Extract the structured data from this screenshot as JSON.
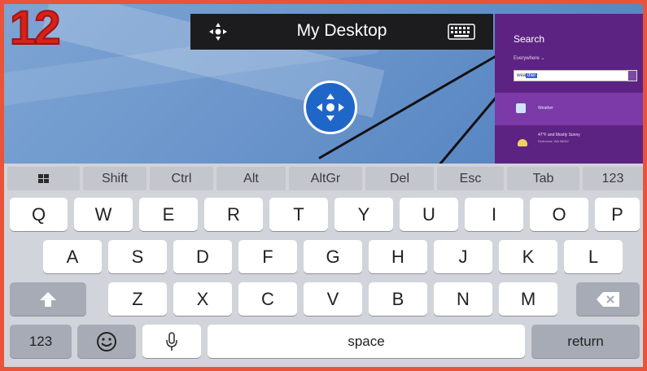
{
  "badge": "12",
  "topbar": {
    "title": "My Desktop",
    "move_icon": "move-arrows-icon",
    "keyboard_icon": "keyboard-icon"
  },
  "search_panel": {
    "title": "Search",
    "scope": "Everywhere ⌄",
    "query_prefix": "wea",
    "query_selected": "ther",
    "result1_label": "Weather",
    "result2_title": "47°F and Mostly Sunny",
    "result2_sub": "Redmond, WA 98052"
  },
  "special_keys": [
    "Shift",
    "Ctrl",
    "Alt",
    "AltGr",
    "Del",
    "Esc",
    "Tab",
    "123"
  ],
  "keyboard": {
    "row1": [
      "Q",
      "W",
      "E",
      "R",
      "T",
      "Y",
      "U",
      "I",
      "O",
      "P"
    ],
    "row2": [
      "A",
      "S",
      "D",
      "F",
      "G",
      "H",
      "J",
      "K",
      "L"
    ],
    "row3": [
      "Z",
      "X",
      "C",
      "V",
      "B",
      "N",
      "M"
    ],
    "numbers_label": "123",
    "space_label": "space",
    "return_label": "return"
  },
  "colors": {
    "frame_accent": "#e8533a",
    "badge": "#d7211b",
    "dpad": "#1f66c9",
    "search_panel": "#5d2382"
  }
}
